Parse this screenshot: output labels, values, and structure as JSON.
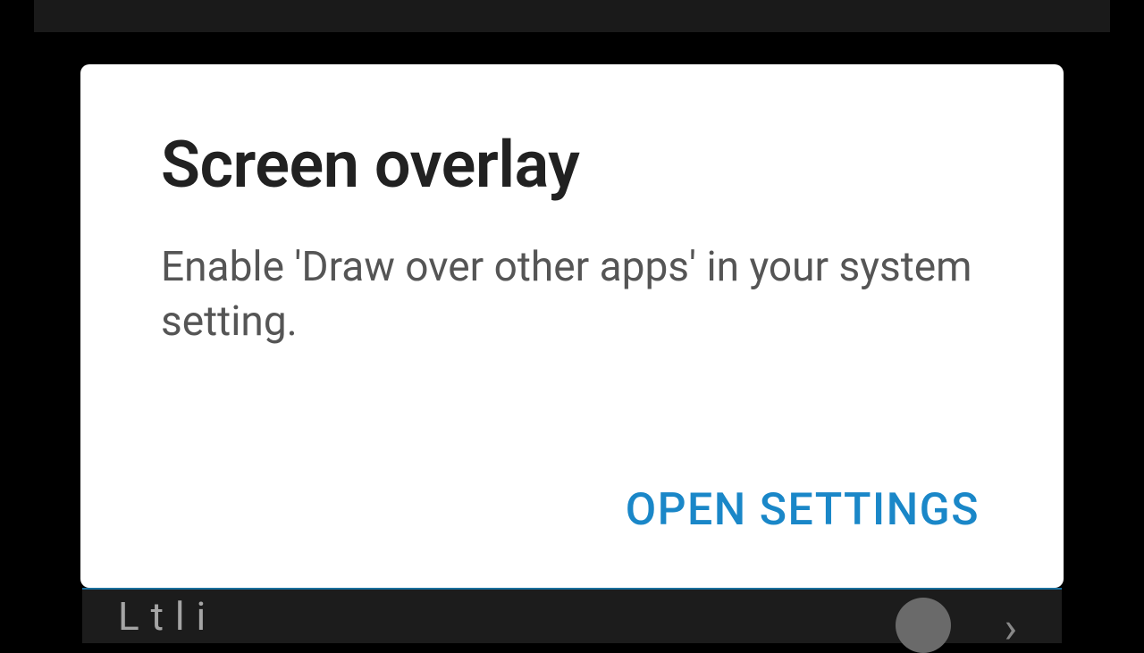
{
  "dialog": {
    "title": "Screen overlay",
    "message": "Enable 'Draw over other apps' in your system setting.",
    "action_label": "OPEN SETTINGS"
  },
  "background": {
    "bottom_text_partial": "L   t     l i"
  }
}
